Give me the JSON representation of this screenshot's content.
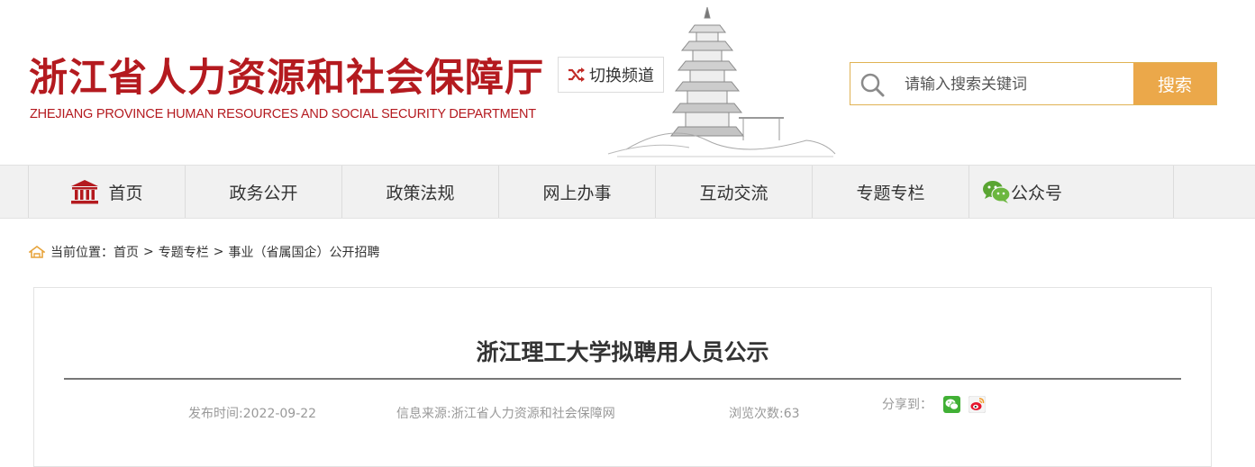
{
  "header": {
    "logo_cn": "浙江省人力资源和社会保障厅",
    "logo_en": "ZHEJIANG PROVINCE HUMAN RESOURCES AND SOCIAL SECURITY DEPARTMENT",
    "switch_label": "切换频道",
    "search_placeholder": "请输入搜索关键词",
    "search_button": "搜索"
  },
  "nav": {
    "items": [
      {
        "label": "首页",
        "icon": "home-building-icon"
      },
      {
        "label": "政务公开"
      },
      {
        "label": "政策法规"
      },
      {
        "label": "网上办事"
      },
      {
        "label": "互动交流"
      },
      {
        "label": "专题专栏"
      },
      {
        "label": "公众号",
        "icon": "wechat-icon"
      }
    ]
  },
  "breadcrumb": {
    "prefix": "当前位置：",
    "items": [
      "首页",
      "专题专栏",
      "事业（省属国企）公开招聘"
    ],
    "separator": ">"
  },
  "article": {
    "title": "浙江理工大学拟聘用人员公示",
    "publish_time": "发布时间:2022-09-22",
    "source": "信息来源:浙江省人力资源和社会保障网",
    "views": "浏览次数:63",
    "share_label": "分享到："
  },
  "colors": {
    "brand_red": "#b41a1f",
    "search_orange": "#eba84a",
    "nav_bg": "#f1f1f1"
  }
}
